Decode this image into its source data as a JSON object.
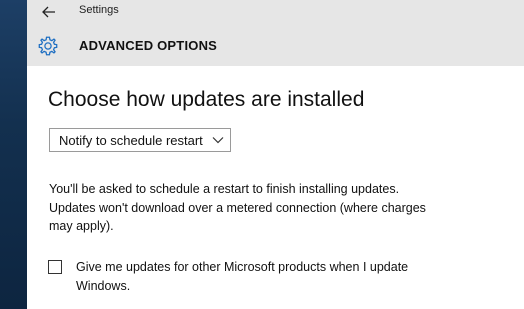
{
  "window": {
    "app_title": "Settings",
    "back_icon": "back-arrow-icon"
  },
  "header": {
    "icon": "gear-icon",
    "title": "ADVANCED OPTIONS"
  },
  "main": {
    "section_title": "Choose how updates are installed",
    "dropdown": {
      "selected": "Notify to schedule restart"
    },
    "description": "You'll be asked to schedule a restart to finish installing updates. Updates won't download over a metered connection (where charges may apply).",
    "checkbox": {
      "checked": false,
      "label": "Give me updates for other Microsoft products when I update Windows."
    }
  },
  "colors": {
    "header_bg": "#e6e6e6",
    "desktop_bg": "#13304f"
  }
}
